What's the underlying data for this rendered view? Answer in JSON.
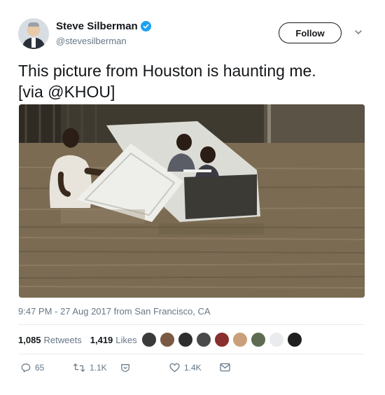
{
  "user": {
    "display_name": "Steve Silberman",
    "handle": "@stevesilberman",
    "verified": true
  },
  "follow_label": "Follow",
  "tweet": {
    "line1": "This picture from Houston is haunting me.",
    "line2": "[via @KHOU]"
  },
  "meta": {
    "timestamp": "9:47 PM - 27 Aug 2017 from San Francisco, CA"
  },
  "stats": {
    "retweets_count": "1,085",
    "retweets_label": "Retweets",
    "likes_count": "1,419",
    "likes_label": "Likes"
  },
  "liker_colors": [
    "#3a3a3a",
    "#7a5a45",
    "#2e2e2e",
    "#4a4a4a",
    "#8b2e2e",
    "#c9a07a",
    "#5e6b52",
    "#e9ebee",
    "#1f1f1f"
  ],
  "actions": {
    "replies": "65",
    "retweets": "1.1K",
    "likes": "1.4K"
  },
  "colors": {
    "accent_blue": "#1da1f2",
    "muted_text": "#657786",
    "text": "#14171a"
  }
}
